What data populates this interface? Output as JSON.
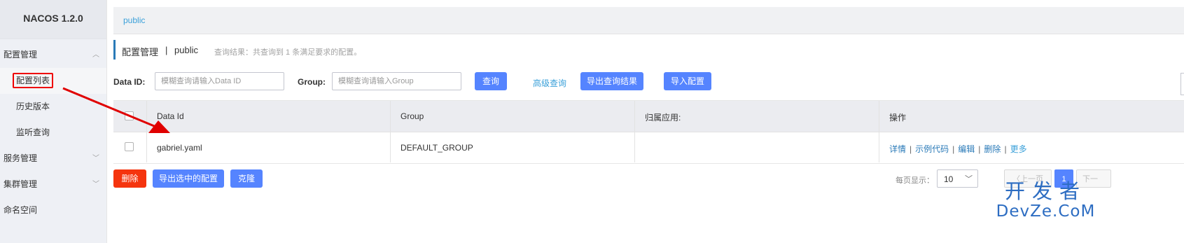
{
  "brand": {
    "title": "NACOS 1.2.0"
  },
  "sidebar": {
    "items": [
      {
        "label": "配置管理"
      },
      {
        "label": "配置列表"
      },
      {
        "label": "历史版本"
      },
      {
        "label": "监听查询"
      },
      {
        "label": "服务管理"
      },
      {
        "label": "集群管理"
      },
      {
        "label": "命名空间"
      }
    ]
  },
  "namespace_bar": {
    "label": "public"
  },
  "header": {
    "title": "配置管理",
    "separator": "|",
    "namespace": "public",
    "result_text": "查询结果：共查询到 1 条满足要求的配置。"
  },
  "search": {
    "data_id_label": "Data ID:",
    "data_id_placeholder": "模糊查询请输入Data ID",
    "group_label": "Group:",
    "group_placeholder": "模糊查询请输入Group",
    "query_button": "查询",
    "advanced_link": "高级查询",
    "export_button": "导出查询结果",
    "import_button": "导入配置"
  },
  "table": {
    "columns": [
      "Data Id",
      "Group",
      "归属应用:",
      "操作"
    ],
    "rows": [
      {
        "data_id": "gabriel.yaml",
        "group": "DEFAULT_GROUP",
        "app": "",
        "ops": [
          "详情",
          "示例代码",
          "编辑",
          "删除",
          "更多"
        ]
      }
    ]
  },
  "bulk": {
    "delete_button": "删除",
    "export_selected_button": "导出选中的配置",
    "clone_button": "克隆"
  },
  "pagination": {
    "page_size_label": "每页显示：",
    "page_size": "10",
    "prev_label": "上一页",
    "current_page": "1",
    "next_label": "下一"
  },
  "annotation": {
    "color": "#e00000"
  },
  "watermark": {
    "line1": "开发者",
    "line2": "DevZe.CoM"
  }
}
